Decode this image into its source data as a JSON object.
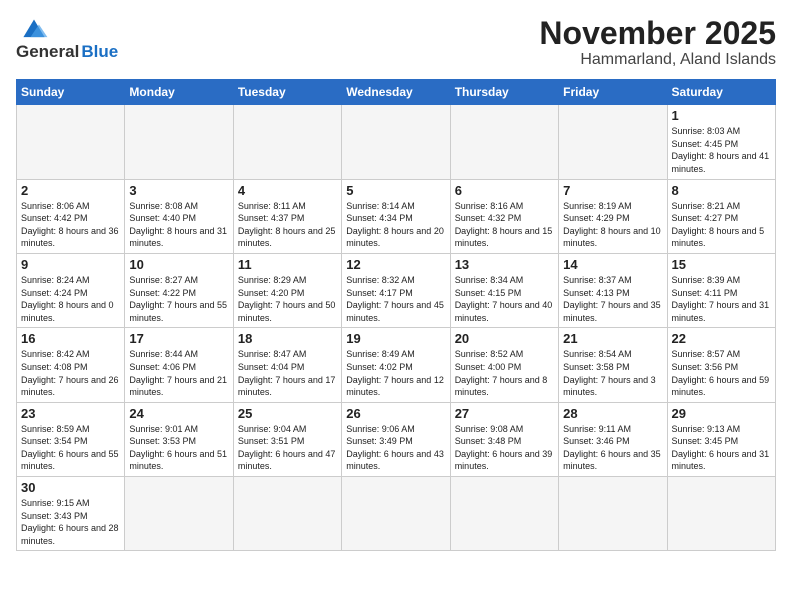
{
  "header": {
    "logo_general": "General",
    "logo_blue": "Blue",
    "month_title": "November 2025",
    "location": "Hammarland, Aland Islands"
  },
  "weekdays": [
    "Sunday",
    "Monday",
    "Tuesday",
    "Wednesday",
    "Thursday",
    "Friday",
    "Saturday"
  ],
  "days": {
    "1": {
      "sunrise": "Sunrise: 8:03 AM",
      "sunset": "Sunset: 4:45 PM",
      "daylight": "Daylight: 8 hours and 41 minutes."
    },
    "2": {
      "sunrise": "Sunrise: 8:06 AM",
      "sunset": "Sunset: 4:42 PM",
      "daylight": "Daylight: 8 hours and 36 minutes."
    },
    "3": {
      "sunrise": "Sunrise: 8:08 AM",
      "sunset": "Sunset: 4:40 PM",
      "daylight": "Daylight: 8 hours and 31 minutes."
    },
    "4": {
      "sunrise": "Sunrise: 8:11 AM",
      "sunset": "Sunset: 4:37 PM",
      "daylight": "Daylight: 8 hours and 25 minutes."
    },
    "5": {
      "sunrise": "Sunrise: 8:14 AM",
      "sunset": "Sunset: 4:34 PM",
      "daylight": "Daylight: 8 hours and 20 minutes."
    },
    "6": {
      "sunrise": "Sunrise: 8:16 AM",
      "sunset": "Sunset: 4:32 PM",
      "daylight": "Daylight: 8 hours and 15 minutes."
    },
    "7": {
      "sunrise": "Sunrise: 8:19 AM",
      "sunset": "Sunset: 4:29 PM",
      "daylight": "Daylight: 8 hours and 10 minutes."
    },
    "8": {
      "sunrise": "Sunrise: 8:21 AM",
      "sunset": "Sunset: 4:27 PM",
      "daylight": "Daylight: 8 hours and 5 minutes."
    },
    "9": {
      "sunrise": "Sunrise: 8:24 AM",
      "sunset": "Sunset: 4:24 PM",
      "daylight": "Daylight: 8 hours and 0 minutes."
    },
    "10": {
      "sunrise": "Sunrise: 8:27 AM",
      "sunset": "Sunset: 4:22 PM",
      "daylight": "Daylight: 7 hours and 55 minutes."
    },
    "11": {
      "sunrise": "Sunrise: 8:29 AM",
      "sunset": "Sunset: 4:20 PM",
      "daylight": "Daylight: 7 hours and 50 minutes."
    },
    "12": {
      "sunrise": "Sunrise: 8:32 AM",
      "sunset": "Sunset: 4:17 PM",
      "daylight": "Daylight: 7 hours and 45 minutes."
    },
    "13": {
      "sunrise": "Sunrise: 8:34 AM",
      "sunset": "Sunset: 4:15 PM",
      "daylight": "Daylight: 7 hours and 40 minutes."
    },
    "14": {
      "sunrise": "Sunrise: 8:37 AM",
      "sunset": "Sunset: 4:13 PM",
      "daylight": "Daylight: 7 hours and 35 minutes."
    },
    "15": {
      "sunrise": "Sunrise: 8:39 AM",
      "sunset": "Sunset: 4:11 PM",
      "daylight": "Daylight: 7 hours and 31 minutes."
    },
    "16": {
      "sunrise": "Sunrise: 8:42 AM",
      "sunset": "Sunset: 4:08 PM",
      "daylight": "Daylight: 7 hours and 26 minutes."
    },
    "17": {
      "sunrise": "Sunrise: 8:44 AM",
      "sunset": "Sunset: 4:06 PM",
      "daylight": "Daylight: 7 hours and 21 minutes."
    },
    "18": {
      "sunrise": "Sunrise: 8:47 AM",
      "sunset": "Sunset: 4:04 PM",
      "daylight": "Daylight: 7 hours and 17 minutes."
    },
    "19": {
      "sunrise": "Sunrise: 8:49 AM",
      "sunset": "Sunset: 4:02 PM",
      "daylight": "Daylight: 7 hours and 12 minutes."
    },
    "20": {
      "sunrise": "Sunrise: 8:52 AM",
      "sunset": "Sunset: 4:00 PM",
      "daylight": "Daylight: 7 hours and 8 minutes."
    },
    "21": {
      "sunrise": "Sunrise: 8:54 AM",
      "sunset": "Sunset: 3:58 PM",
      "daylight": "Daylight: 7 hours and 3 minutes."
    },
    "22": {
      "sunrise": "Sunrise: 8:57 AM",
      "sunset": "Sunset: 3:56 PM",
      "daylight": "Daylight: 6 hours and 59 minutes."
    },
    "23": {
      "sunrise": "Sunrise: 8:59 AM",
      "sunset": "Sunset: 3:54 PM",
      "daylight": "Daylight: 6 hours and 55 minutes."
    },
    "24": {
      "sunrise": "Sunrise: 9:01 AM",
      "sunset": "Sunset: 3:53 PM",
      "daylight": "Daylight: 6 hours and 51 minutes."
    },
    "25": {
      "sunrise": "Sunrise: 9:04 AM",
      "sunset": "Sunset: 3:51 PM",
      "daylight": "Daylight: 6 hours and 47 minutes."
    },
    "26": {
      "sunrise": "Sunrise: 9:06 AM",
      "sunset": "Sunset: 3:49 PM",
      "daylight": "Daylight: 6 hours and 43 minutes."
    },
    "27": {
      "sunrise": "Sunrise: 9:08 AM",
      "sunset": "Sunset: 3:48 PM",
      "daylight": "Daylight: 6 hours and 39 minutes."
    },
    "28": {
      "sunrise": "Sunrise: 9:11 AM",
      "sunset": "Sunset: 3:46 PM",
      "daylight": "Daylight: 6 hours and 35 minutes."
    },
    "29": {
      "sunrise": "Sunrise: 9:13 AM",
      "sunset": "Sunset: 3:45 PM",
      "daylight": "Daylight: 6 hours and 31 minutes."
    },
    "30": {
      "sunrise": "Sunrise: 9:15 AM",
      "sunset": "Sunset: 3:43 PM",
      "daylight": "Daylight: 6 hours and 28 minutes."
    }
  }
}
